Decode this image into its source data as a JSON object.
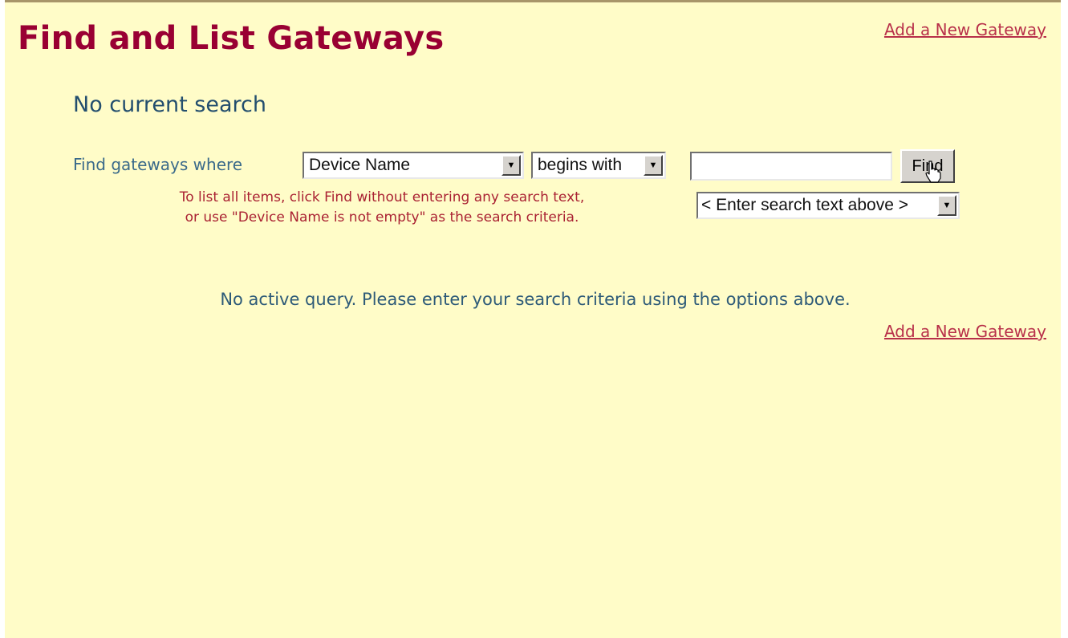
{
  "header": {
    "title": "Find and List Gateways",
    "add_link": "Add a New Gateway"
  },
  "search": {
    "status": "No current search",
    "label": "Find gateways where",
    "field_select": "Device Name",
    "operator_select": "begins with",
    "text_value": "",
    "find_button": "Find",
    "hint_select": "< Enter search text above >",
    "help_line1": "To list all items, click Find without entering any search text,",
    "help_line2": "or use \"Device Name is not empty\" as the search criteria."
  },
  "results": {
    "message": "No active query. Please enter your search criteria using the options above.",
    "add_link": "Add a New Gateway"
  },
  "colors": {
    "background": "#fffcc8",
    "title": "#990033",
    "link": "#b8304a",
    "text": "#2d5a78"
  },
  "icons": {
    "dropdown": "chevron-down-icon",
    "cursor": "hand-pointer-cursor-icon"
  }
}
